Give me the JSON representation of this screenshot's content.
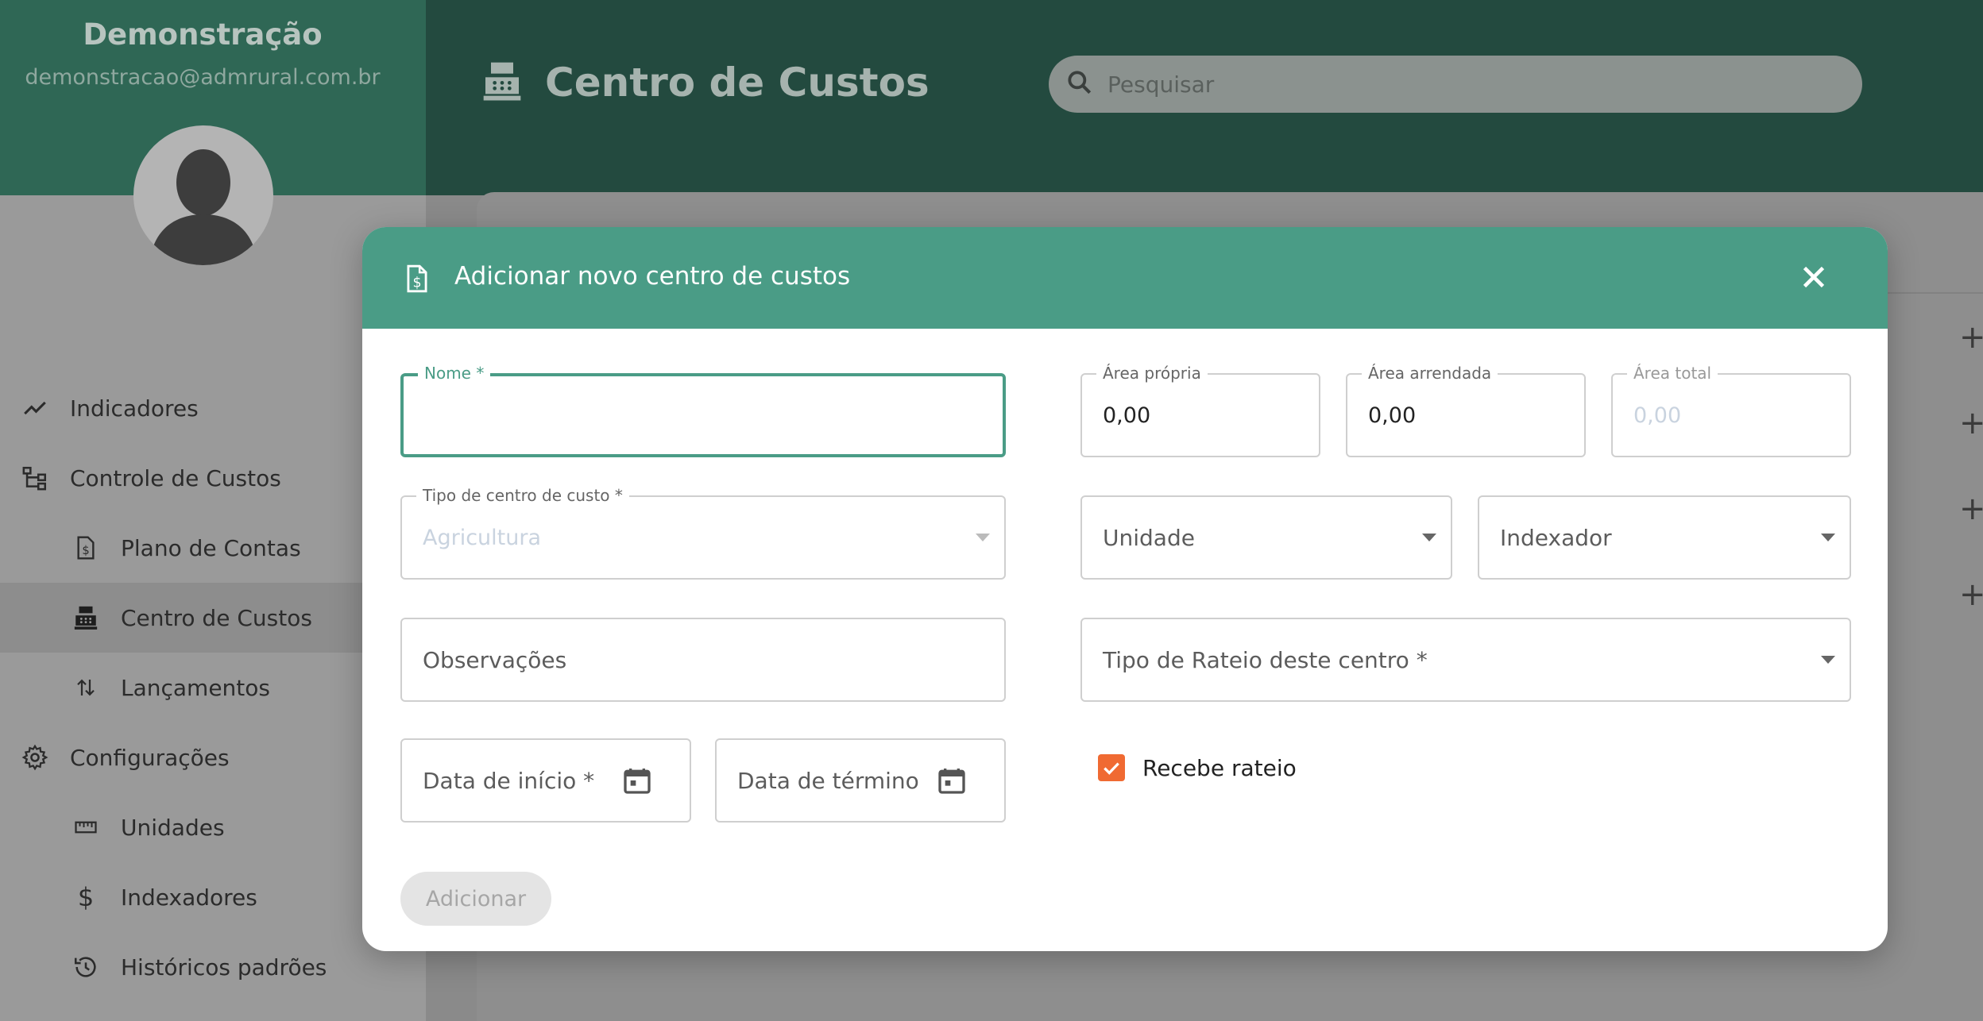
{
  "sidebar": {
    "user_name": "Demonstração",
    "user_email": "demonstracao@admrural.com.br",
    "items": [
      {
        "label": "Indicadores",
        "icon": "trend-line-icon"
      },
      {
        "label": "Controle de Custos",
        "icon": "hierarchy-icon"
      },
      {
        "label": "Plano de Contas",
        "icon": "dollar-document-icon"
      },
      {
        "label": "Centro de Custos",
        "icon": "cash-register-icon",
        "active": true
      },
      {
        "label": "Lançamentos",
        "icon": "swap-vertical-icon"
      },
      {
        "label": "Configurações",
        "icon": "gear-icon"
      },
      {
        "label": "Unidades",
        "icon": "ruler-icon"
      },
      {
        "label": "Indexadores",
        "icon": "dollar-icon"
      },
      {
        "label": "Históricos padrões",
        "icon": "history-icon"
      }
    ]
  },
  "header": {
    "title": "Centro de Custos",
    "search_placeholder": "Pesquisar"
  },
  "modal": {
    "title": "Adicionar novo centro de custos",
    "fields": {
      "nome": {
        "label": "Nome *",
        "value": ""
      },
      "tipo": {
        "label": "Tipo de centro de custo *",
        "value": "Agricultura"
      },
      "observacoes": {
        "placeholder": "Observações"
      },
      "data_inicio": {
        "placeholder": "Data de início *"
      },
      "data_termino": {
        "placeholder": "Data de término"
      },
      "area_propria": {
        "label": "Área própria",
        "value": "0,00"
      },
      "area_arrendada": {
        "label": "Área arrendada",
        "value": "0,00"
      },
      "area_total": {
        "label": "Área total",
        "value": "0,00"
      },
      "unidade": {
        "placeholder": "Unidade"
      },
      "indexador": {
        "placeholder": "Indexador"
      },
      "tipo_rateio": {
        "placeholder": "Tipo de Rateio deste centro *"
      }
    },
    "checkbox": {
      "label": "Recebe rateio",
      "checked": true
    },
    "submit_label": "Adicionar"
  },
  "colors": {
    "accent": "#4a9c86",
    "header_dark": "#234a3f",
    "checkbox": "#f06a32"
  }
}
